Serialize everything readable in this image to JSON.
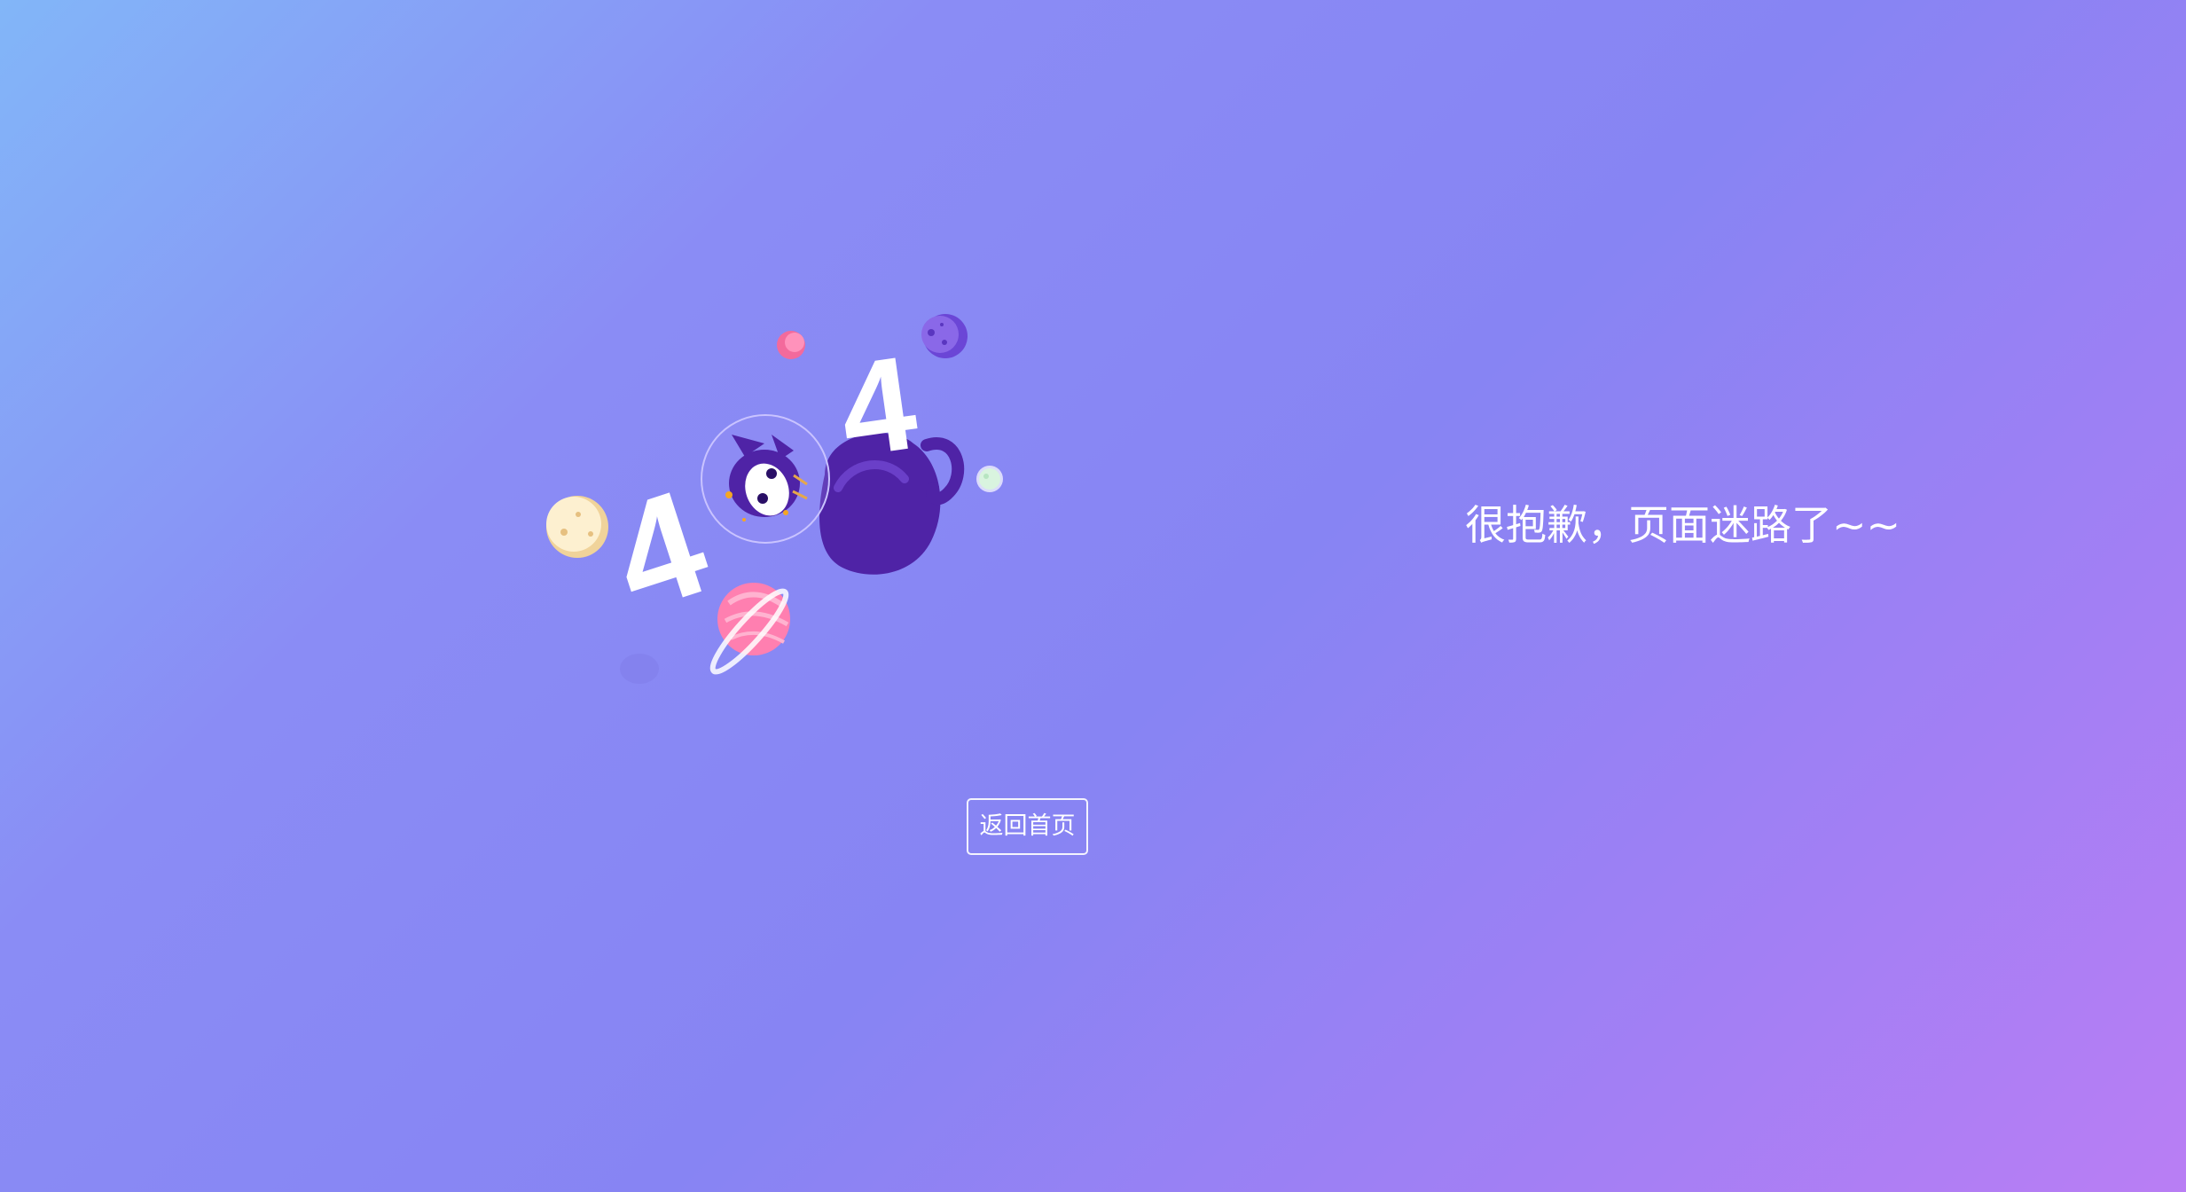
{
  "message": {
    "text": "很抱歉，页面迷路了~~"
  },
  "home_button": {
    "label": "返回首页"
  },
  "illustration": {
    "icon": "astronaut-cat-404-icon",
    "digit_left": "4",
    "digit_right": "4"
  },
  "colors": {
    "background_start": "#82b6f8",
    "background_mid": "#8784f3",
    "background_end": "#b97ef4",
    "cat": "#4f23a6",
    "planet_pink": "#ff86b3",
    "moon_cream": "#fbeac2",
    "text": "#ffffff"
  }
}
